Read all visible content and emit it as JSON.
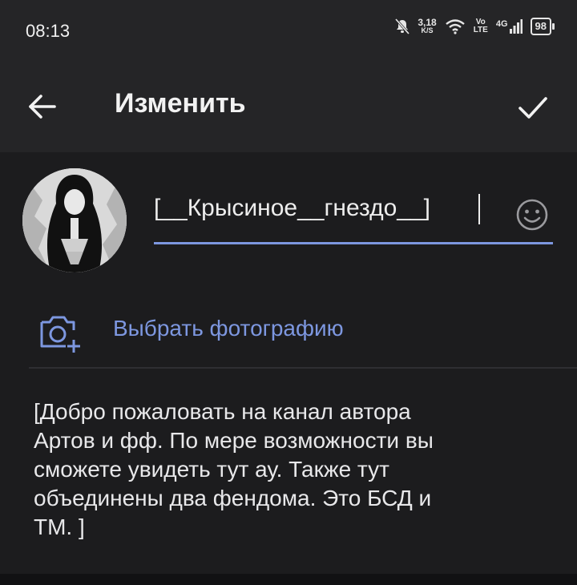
{
  "status": {
    "time": "08:13",
    "speed_value": "3,18",
    "speed_unit": "K/S",
    "volte_top": "Vo",
    "volte_bottom": "LTE",
    "network": "4G",
    "battery": "98"
  },
  "toolbar": {
    "title": "Изменить",
    "back_icon": "arrow-left-icon",
    "done_icon": "check-icon"
  },
  "channel": {
    "name": "[__Крысиное__гнездо__]",
    "photo_label": "Выбрать фотографию",
    "description": "[Добро пожаловать на канал автора\nАртов и фф. По мере возможности вы\nсможете увидеть тут ау. Также тут\nобъединены два фендома. Это БСД и\nТМ. ]"
  },
  "colors": {
    "accent": "#7d97e0",
    "background": "#1c1c1e",
    "header": "#252527"
  }
}
